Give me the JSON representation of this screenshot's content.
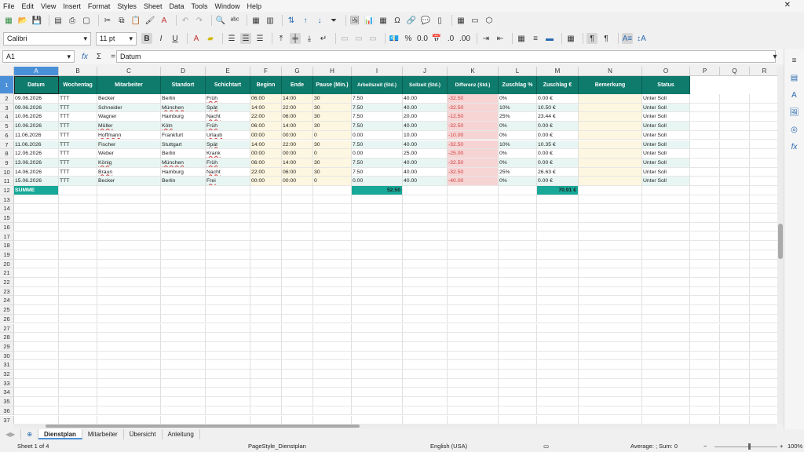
{
  "menu": [
    "File",
    "Edit",
    "View",
    "Insert",
    "Format",
    "Styles",
    "Sheet",
    "Data",
    "Tools",
    "Window",
    "Help"
  ],
  "font": {
    "name": "Calibri",
    "size": "11 pt"
  },
  "namebox": "A1",
  "formula": "Datum",
  "columns": [
    "A",
    "B",
    "C",
    "D",
    "E",
    "F",
    "G",
    "H",
    "I",
    "J",
    "K",
    "L",
    "M",
    "N",
    "O",
    "P",
    "Q",
    "R"
  ],
  "headers": [
    "Datum",
    "Wochentag",
    "Mitarbeiter",
    "Standort",
    "Schichtart",
    "Beginn",
    "Ende",
    "Pause (Min.)",
    "Arbeitszeit (Std.)",
    "Sollzeit (Std.)",
    "Differenz (Std.)",
    "Zuschlag %",
    "Zuschlag €",
    "Bemerkung",
    "Status"
  ],
  "rows": [
    [
      "09.06.2026",
      "TTT",
      "Becker",
      "Berlin",
      "Früh",
      "06:00",
      "14:00",
      "30",
      "7.50",
      "40.00",
      "-32.50",
      "0%",
      "0.00 €",
      "",
      "Unter Soll"
    ],
    [
      "09.06.2026",
      "TTT",
      "Schneider",
      "München",
      "Spät",
      "14:00",
      "22:00",
      "30",
      "7.50",
      "40.00",
      "-32.50",
      "10%",
      "10.50 €",
      "",
      "Unter Soll"
    ],
    [
      "10.06.2026",
      "TTT",
      "Wagner",
      "Hamburg",
      "Nacht",
      "22:00",
      "06:00",
      "30",
      "7.50",
      "20.00",
      "-12.50",
      "25%",
      "23.44 €",
      "",
      "Unter Soll"
    ],
    [
      "10.06.2026",
      "TTT",
      "Müller",
      "Köln",
      "Früh",
      "06:00",
      "14:00",
      "30",
      "7.50",
      "40.00",
      "-32.50",
      "0%",
      "0.00 €",
      "",
      "Unter Soll"
    ],
    [
      "11.06.2026",
      "TTT",
      "Hoffmann",
      "Frankfurt",
      "Urlaub",
      "00:00",
      "00:00",
      "0",
      "0.00",
      "10.00",
      "-10.00",
      "0%",
      "0.00 €",
      "",
      "Unter Soll"
    ],
    [
      "11.06.2026",
      "TTT",
      "Fischer",
      "Stuttgart",
      "Spät",
      "14:00",
      "22:00",
      "30",
      "7.50",
      "40.00",
      "-32.50",
      "10%",
      "10.35 €",
      "",
      "Unter Soll"
    ],
    [
      "12.06.2026",
      "TTT",
      "Weber",
      "Berlin",
      "Krank",
      "00:00",
      "00:00",
      "0",
      "0.00",
      "25.00",
      "-25.00",
      "0%",
      "0.00 €",
      "",
      "Unter Soll"
    ],
    [
      "13.06.2026",
      "TTT",
      "König",
      "München",
      "Früh",
      "06:00",
      "14:00",
      "30",
      "7.50",
      "40.00",
      "-32.50",
      "0%",
      "0.00 €",
      "",
      "Unter Soll"
    ],
    [
      "14.06.2026",
      "TTT",
      "Braun",
      "Hamburg",
      "Nacht",
      "22:00",
      "06:00",
      "30",
      "7.50",
      "40.00",
      "-32.50",
      "25%",
      "26.63 €",
      "",
      "Unter Soll"
    ],
    [
      "15.06.2026",
      "TTT",
      "Becker",
      "Berlin",
      "Frei",
      "00:00",
      "00:00",
      "0",
      "0.00",
      "40.00",
      "-40.00",
      "0%",
      "0.00 €",
      "",
      "Unter Soll"
    ]
  ],
  "summe": {
    "label": "SUMME",
    "arbeitszeit": "52.50",
    "zuschlag": "70.91 €"
  },
  "tabs": [
    "Dienstplan",
    "Mitarbeiter",
    "Übersicht",
    "Anleitung"
  ],
  "status": {
    "sheet": "Sheet 1 of 4",
    "pagestyle": "PageStyle_Dienstplan",
    "language": "English (USA)",
    "sum": "Average: ; Sum: 0",
    "zoom": "100%"
  },
  "colors": {
    "header": "#0f7b6c",
    "negative": "#f7d4d4",
    "neg_text": "#d04040",
    "alt_row": "#e8f6f3",
    "cream": "#fdf6e0"
  }
}
